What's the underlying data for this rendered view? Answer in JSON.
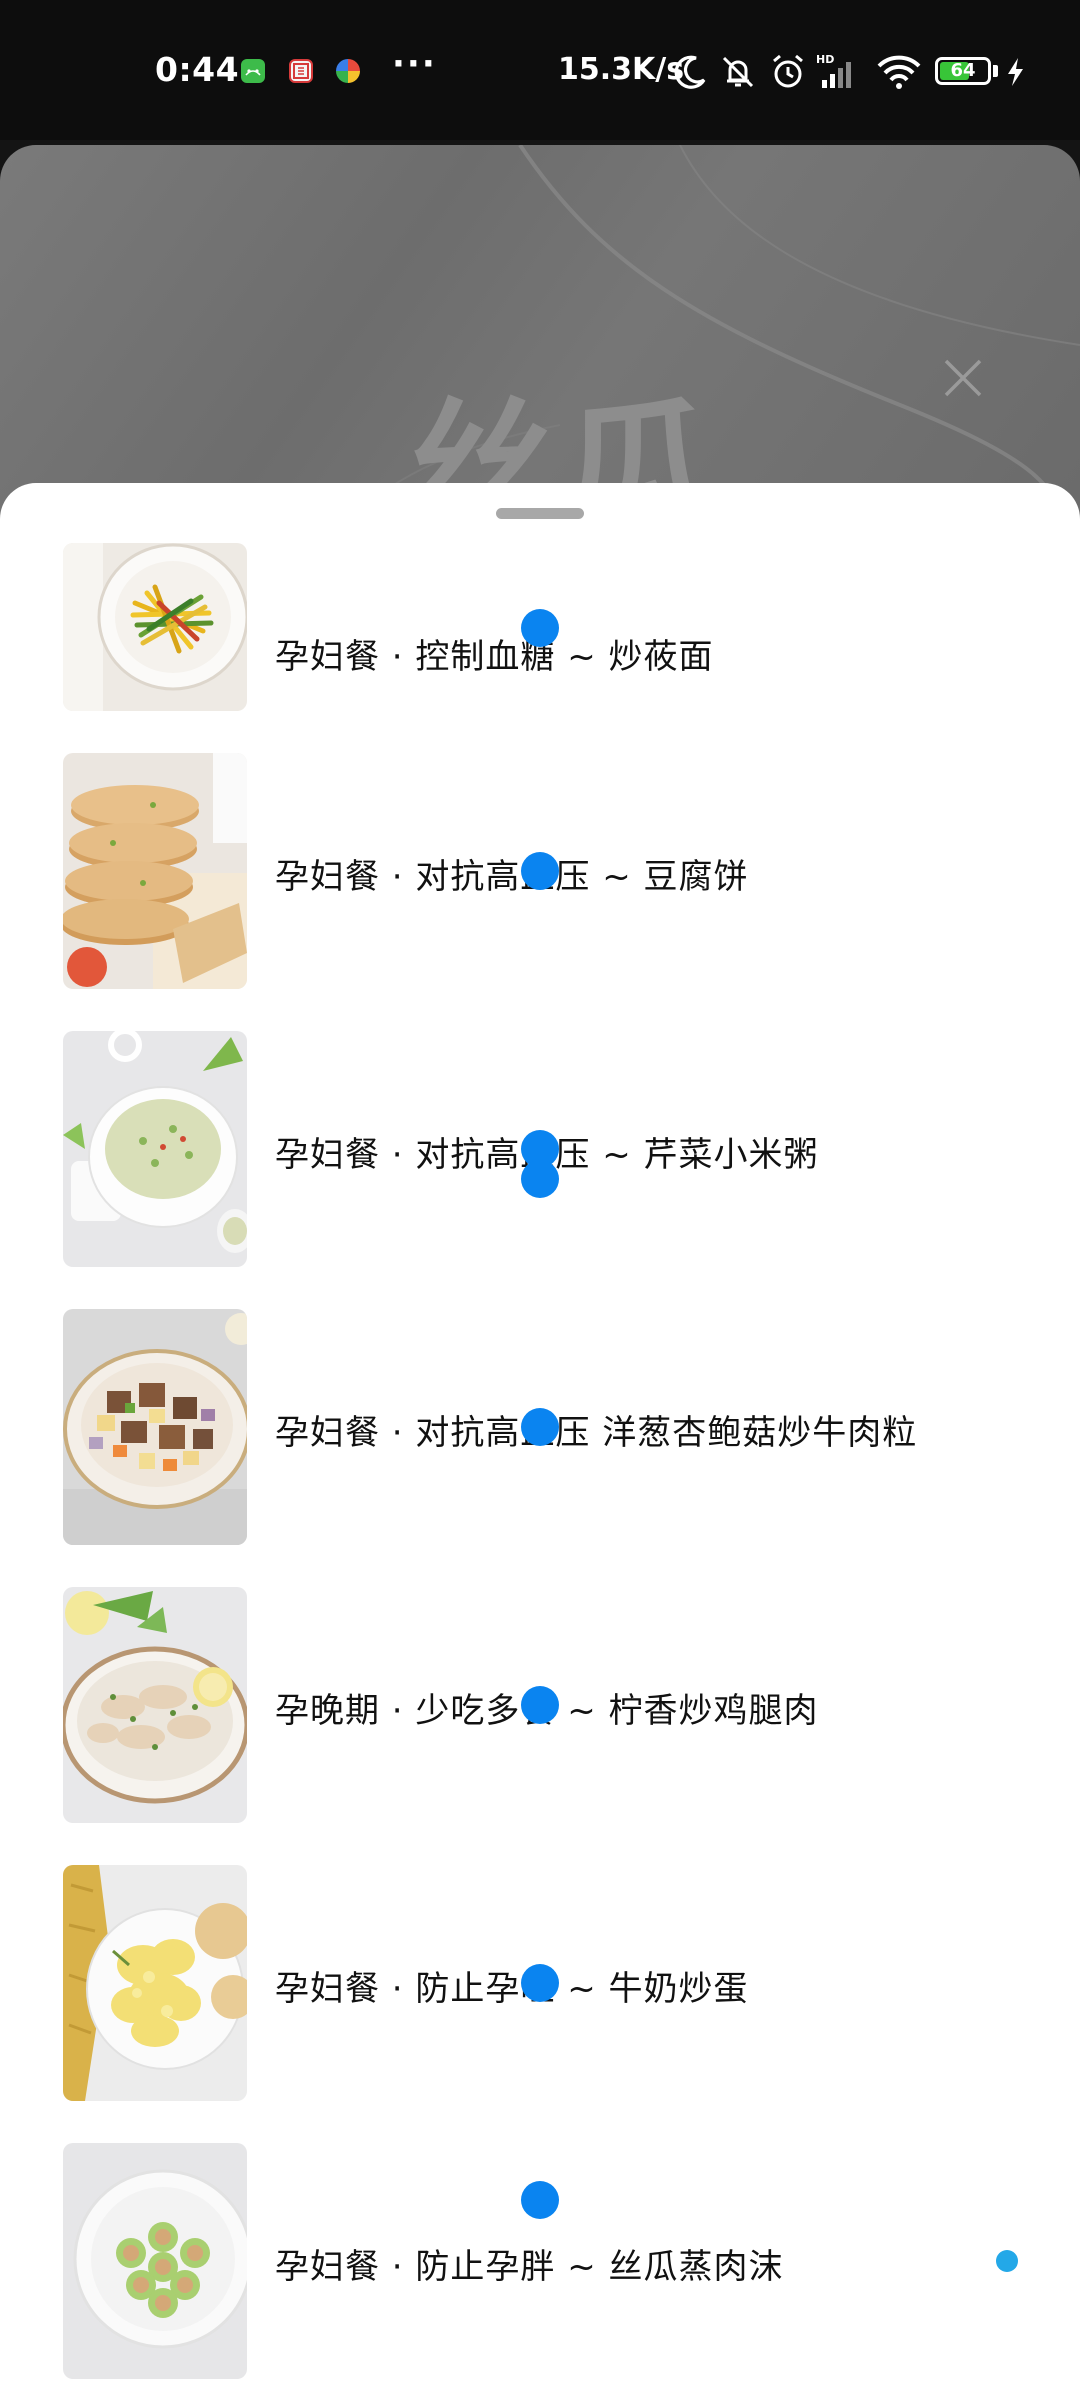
{
  "status_bar": {
    "time": "0:44",
    "network_speed": "15.3K/s",
    "battery_level": "64",
    "battery_percent": 64,
    "icons": [
      "android-app-icon",
      "calendar-app-icon",
      "colorful-app-icon",
      "more-dots-icon",
      "moon-icon",
      "mute-bell-icon",
      "alarm-icon",
      "hd-signal-icon",
      "wifi-icon",
      "battery-icon",
      "charging-icon"
    ],
    "more_dots": "···"
  },
  "background_card": {
    "watermark_text": "丝瓜",
    "close_icon": "close-icon"
  },
  "recipes": [
    {
      "title": "孕妇餐 · 控制血糖 ~ 炒莜面",
      "image": "stir-fried-oat-noodles"
    },
    {
      "title": "孕妇餐 · 对抗高血压 ~ 豆腐饼",
      "image": "tofu-patties"
    },
    {
      "title": "孕妇餐 · 对抗高血压 ~ 芹菜小米粥",
      "image": "celery-millet-porridge"
    },
    {
      "title": "孕妇餐 · 对抗高血压 洋葱杏鲍菇炒牛肉粒",
      "image": "beef-mushroom-stirfry"
    },
    {
      "title": "孕晚期 · 少吃多餐 ~ 柠香炒鸡腿肉",
      "image": "lemon-chicken"
    },
    {
      "title": "孕妇餐 · 防止孕吐 ~ 牛奶炒蛋",
      "image": "milk-scrambled-eggs"
    },
    {
      "title": "孕妇餐 · 防止孕胖 ~ 丝瓜蒸肉沫",
      "image": "loofah-steamed-pork"
    }
  ],
  "colors": {
    "touch_indicator": "#0a84f0",
    "sheet_background": "#ffffff",
    "handle": "#a8a8a8"
  }
}
